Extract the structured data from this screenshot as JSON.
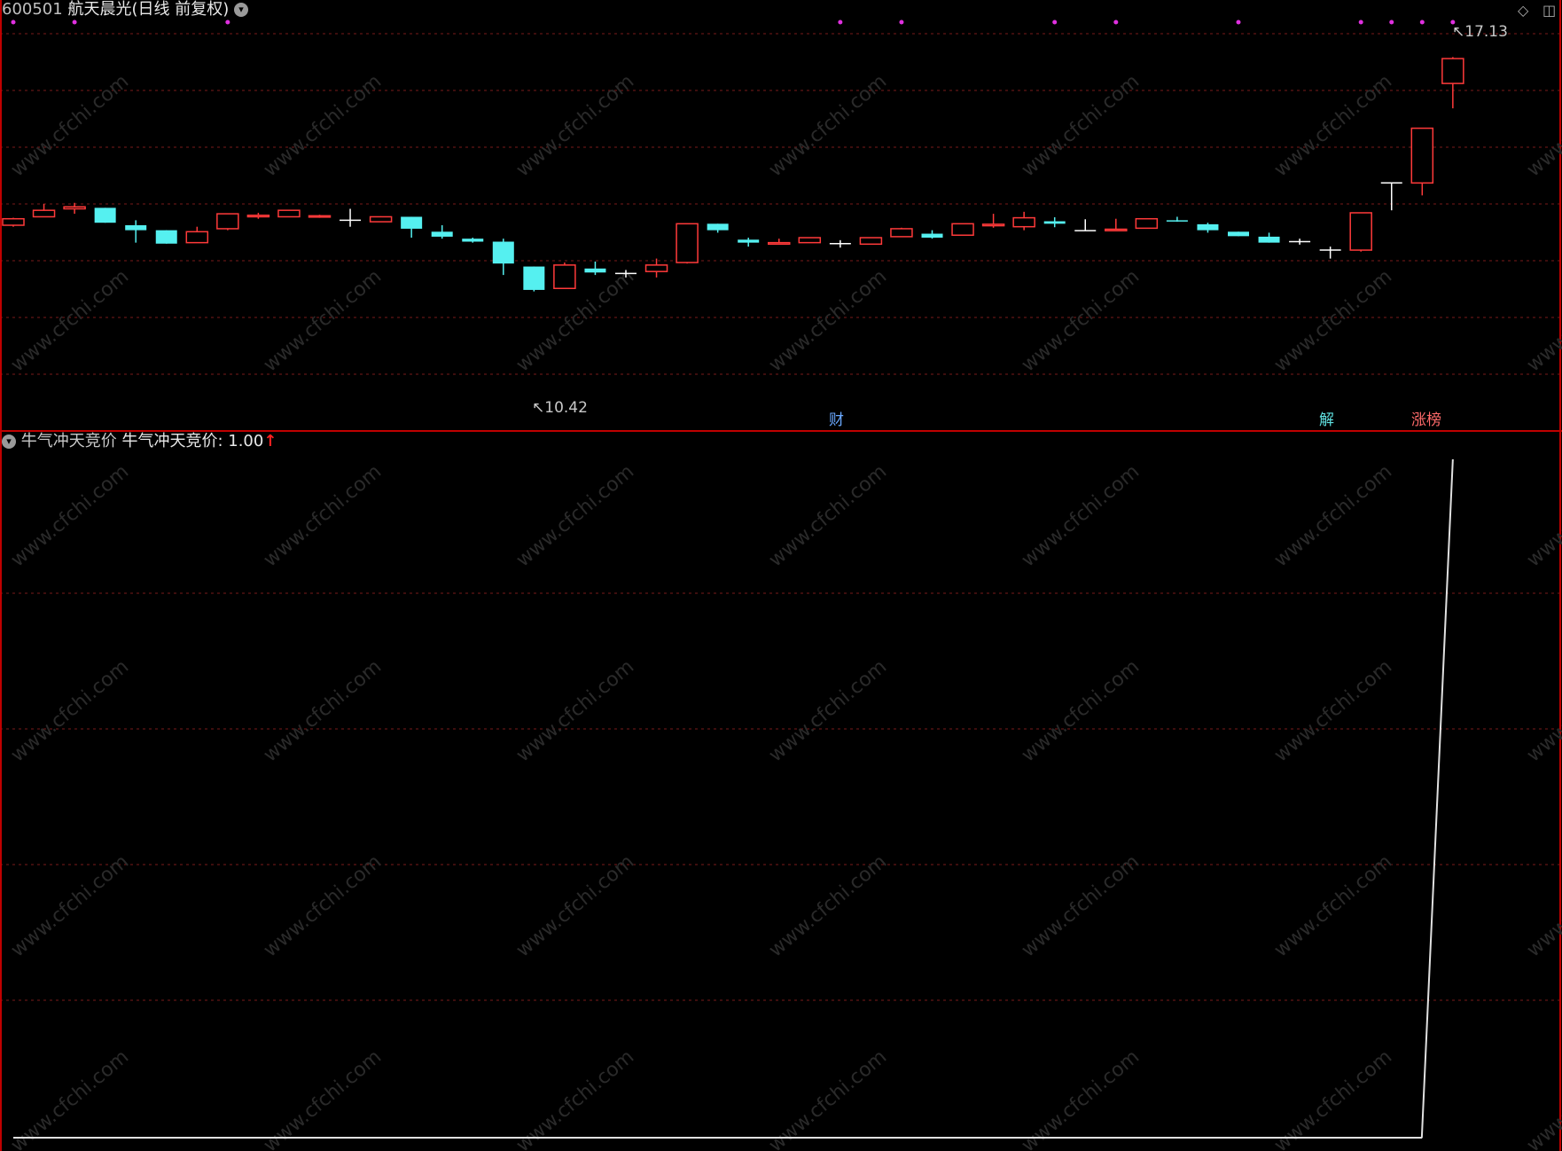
{
  "header": {
    "stock_code": "600501",
    "stock_name": "航天晨光(日线 前复权)",
    "dropdown_icon": "chevron-down-icon"
  },
  "corner_icons": [
    "diamond-icon",
    "window-toggle-icon"
  ],
  "price_labels": {
    "high": "17.13",
    "low": "10.42"
  },
  "event_tags": {
    "finance": "财",
    "unlock": "解",
    "limit_up": "涨榜"
  },
  "indicator_header": {
    "name": "牛气冲天竞价",
    "value_text": "牛气冲天竞价: 1.00",
    "arrow": "↑"
  },
  "colors": {
    "up": "#ff3a3a",
    "down": "#55f0f0",
    "flat": "#ffffff",
    "grid": "#7a1a1a",
    "separator": "#c00000",
    "marker": "#e030e0",
    "indicator_line": "#e0e0e0"
  },
  "chart_data": [
    {
      "type": "candlestick",
      "title": "600501 航天晨光(日线 前复权)",
      "ylim": [
        9.9,
        17.6
      ],
      "annotations": [
        {
          "text": "17.13",
          "at": "max-high"
        },
        {
          "text": "10.42",
          "at": "min-low"
        }
      ],
      "candles": [
        {
          "o": 13.75,
          "c": 13.88,
          "h": 13.9,
          "l": 13.72
        },
        {
          "o": 13.92,
          "c": 14.05,
          "h": 14.18,
          "l": 13.92
        },
        {
          "o": 14.08,
          "c": 14.12,
          "h": 14.2,
          "l": 13.98
        },
        {
          "o": 14.1,
          "c": 13.8,
          "h": 14.1,
          "l": 13.8
        },
        {
          "o": 13.75,
          "c": 13.65,
          "h": 13.85,
          "l": 13.4
        },
        {
          "o": 13.65,
          "c": 13.38,
          "h": 13.65,
          "l": 13.38
        },
        {
          "o": 13.4,
          "c": 13.62,
          "h": 13.72,
          "l": 13.4
        },
        {
          "o": 13.68,
          "c": 13.98,
          "h": 13.98,
          "l": 13.65
        },
        {
          "o": 13.92,
          "c": 13.95,
          "h": 14.0,
          "l": 13.88
        },
        {
          "o": 13.92,
          "c": 14.05,
          "h": 14.05,
          "l": 13.92
        },
        {
          "o": 13.92,
          "c": 13.94,
          "h": 13.96,
          "l": 13.9
        },
        {
          "o": 13.85,
          "c": 13.85,
          "h": 14.08,
          "l": 13.72
        },
        {
          "o": 13.82,
          "c": 13.92,
          "h": 13.93,
          "l": 13.82
        },
        {
          "o": 13.92,
          "c": 13.68,
          "h": 13.92,
          "l": 13.5
        },
        {
          "o": 13.62,
          "c": 13.52,
          "h": 13.75,
          "l": 13.48
        },
        {
          "o": 13.48,
          "c": 13.42,
          "h": 13.5,
          "l": 13.4
        },
        {
          "o": 13.42,
          "c": 12.98,
          "h": 13.48,
          "l": 12.75
        },
        {
          "o": 12.92,
          "c": 12.45,
          "h": 12.92,
          "l": 12.42
        },
        {
          "o": 12.48,
          "c": 12.95,
          "h": 13.0,
          "l": 12.48
        },
        {
          "o": 12.88,
          "c": 12.8,
          "h": 13.02,
          "l": 12.75
        },
        {
          "o": 12.78,
          "c": 12.78,
          "h": 12.85,
          "l": 12.7
        },
        {
          "o": 12.82,
          "c": 12.95,
          "h": 13.08,
          "l": 12.7
        },
        {
          "o": 13.0,
          "c": 13.78,
          "h": 13.78,
          "l": 12.98
        },
        {
          "o": 13.78,
          "c": 13.65,
          "h": 13.78,
          "l": 13.6
        },
        {
          "o": 13.46,
          "c": 13.4,
          "h": 13.5,
          "l": 13.32
        },
        {
          "o": 13.37,
          "c": 13.4,
          "h": 13.48,
          "l": 13.37
        },
        {
          "o": 13.4,
          "c": 13.5,
          "h": 13.5,
          "l": 13.4
        },
        {
          "o": 13.38,
          "c": 13.38,
          "h": 13.45,
          "l": 13.3
        },
        {
          "o": 13.37,
          "c": 13.5,
          "h": 13.5,
          "l": 13.37
        },
        {
          "o": 13.52,
          "c": 13.68,
          "h": 13.7,
          "l": 13.52
        },
        {
          "o": 13.58,
          "c": 13.5,
          "h": 13.65,
          "l": 13.48
        },
        {
          "o": 13.55,
          "c": 13.78,
          "h": 13.78,
          "l": 13.55
        },
        {
          "o": 13.74,
          "c": 13.77,
          "h": 13.98,
          "l": 13.7
        },
        {
          "o": 13.72,
          "c": 13.9,
          "h": 14.02,
          "l": 13.65
        },
        {
          "o": 13.83,
          "c": 13.78,
          "h": 13.91,
          "l": 13.71
        },
        {
          "o": 13.64,
          "c": 13.64,
          "h": 13.87,
          "l": 13.64
        },
        {
          "o": 13.64,
          "c": 13.67,
          "h": 13.88,
          "l": 13.64
        },
        {
          "o": 13.69,
          "c": 13.88,
          "h": 13.88,
          "l": 13.69
        },
        {
          "o": 13.85,
          "c": 13.83,
          "h": 13.92,
          "l": 13.82
        },
        {
          "o": 13.77,
          "c": 13.65,
          "h": 13.8,
          "l": 13.6
        },
        {
          "o": 13.62,
          "c": 13.53,
          "h": 13.62,
          "l": 13.53
        },
        {
          "o": 13.52,
          "c": 13.4,
          "h": 13.6,
          "l": 13.4
        },
        {
          "o": 13.42,
          "c": 13.42,
          "h": 13.48,
          "l": 13.36
        },
        {
          "o": 13.25,
          "c": 13.25,
          "h": 13.32,
          "l": 13.08
        },
        {
          "o": 13.25,
          "c": 14.0,
          "h": 14.0,
          "l": 13.22
        },
        {
          "o": 14.6,
          "c": 14.6,
          "h": 14.6,
          "l": 14.05
        },
        {
          "o": 14.6,
          "c": 15.7,
          "h": 15.7,
          "l": 14.35
        },
        {
          "o": 16.6,
          "c": 17.1,
          "h": 17.13,
          "l": 16.1
        }
      ],
      "top_marker_indices": [
        0,
        2,
        7,
        27,
        29,
        34,
        36,
        40,
        44,
        45,
        46,
        47
      ],
      "event_marker_indices": {
        "finance": 27,
        "unlock": 43,
        "limit_up": 46
      }
    },
    {
      "type": "line",
      "title": "牛气冲天竞价",
      "series": [
        {
          "name": "牛气冲天竞价",
          "values": [
            0,
            0,
            0,
            0,
            0,
            0,
            0,
            0,
            0,
            0,
            0,
            0,
            0,
            0,
            0,
            0,
            0,
            0,
            0,
            0,
            0,
            0,
            0,
            0,
            0,
            0,
            0,
            0,
            0,
            0,
            0,
            0,
            0,
            0,
            0,
            0,
            0,
            0,
            0,
            0,
            0,
            0,
            0,
            0,
            0,
            0,
            0,
            1.0
          ]
        }
      ],
      "ylim": [
        0,
        1.0
      ]
    }
  ]
}
